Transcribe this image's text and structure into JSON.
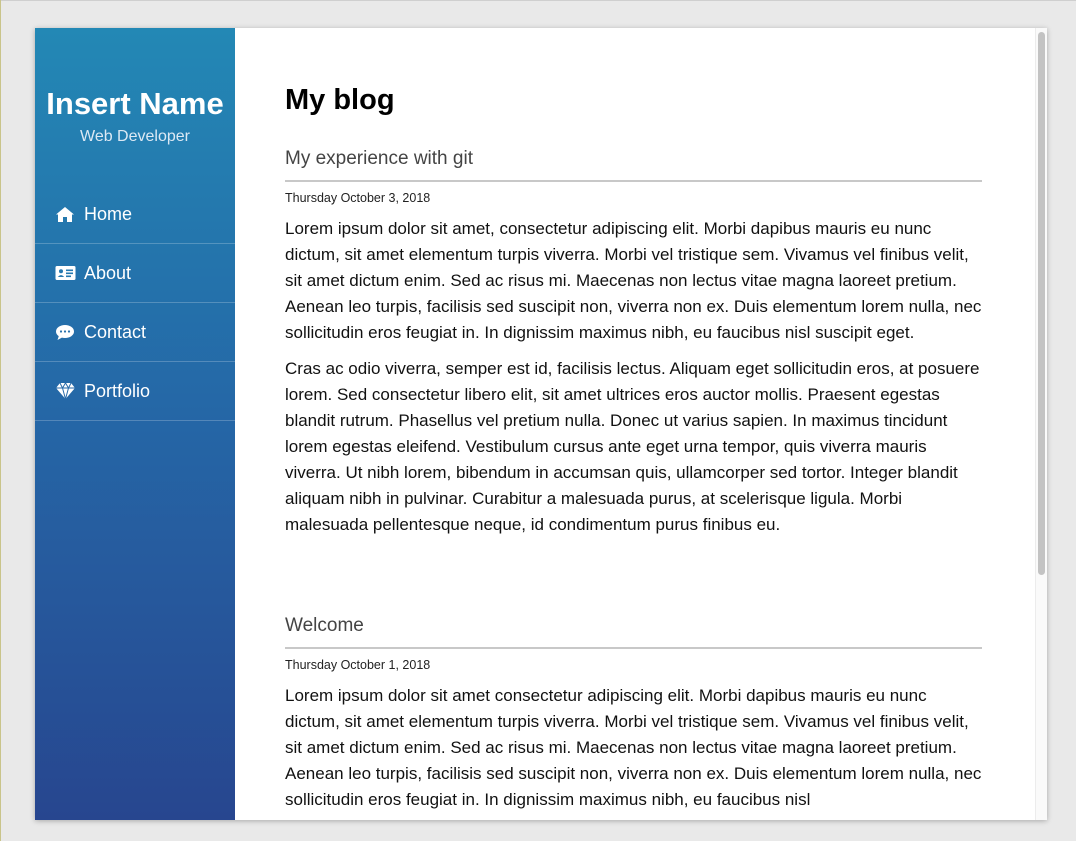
{
  "sidebar": {
    "brand_name": "Insert Name",
    "brand_subtitle": "Web Developer",
    "items": [
      {
        "label": "Home",
        "icon": "home-icon"
      },
      {
        "label": "About",
        "icon": "id-card-icon"
      },
      {
        "label": "Contact",
        "icon": "chat-bubble-icon"
      },
      {
        "label": "Portfolio",
        "icon": "diamond-icon"
      }
    ]
  },
  "main": {
    "title": "My blog",
    "posts": [
      {
        "title": "My experience with git",
        "date": "Thursday October 3, 2018",
        "paragraphs": [
          "Lorem ipsum dolor sit amet, consectetur adipiscing elit. Morbi dapibus mauris eu nunc dictum, sit amet elementum turpis viverra. Morbi vel tristique sem. Vivamus vel finibus velit, sit amet dictum enim. Sed ac risus mi. Maecenas non lectus vitae magna laoreet pretium. Aenean leo turpis, facilisis sed suscipit non, viverra non ex. Duis elementum lorem nulla, nec sollicitudin eros feugiat in. In dignissim maximus nibh, eu faucibus nisl suscipit eget.",
          "Cras ac odio viverra, semper est id, facilisis lectus. Aliquam eget sollicitudin eros, at posuere lorem. Sed consectetur libero elit, sit amet ultrices eros auctor mollis. Praesent egestas blandit rutrum. Phasellus vel pretium nulla. Donec ut varius sapien. In maximus tincidunt lorem egestas eleifend. Vestibulum cursus ante eget urna tempor, quis viverra mauris viverra. Ut nibh lorem, bibendum in accumsan quis, ullamcorper sed tortor. Integer blandit aliquam nibh in pulvinar. Curabitur a malesuada purus, at scelerisque ligula. Morbi malesuada pellentesque neque, id condimentum purus finibus eu."
        ]
      },
      {
        "title": "Welcome",
        "date": "Thursday October 1, 2018",
        "paragraphs": [
          "Lorem ipsum dolor sit amet consectetur adipiscing elit. Morbi dapibus mauris eu nunc dictum, sit amet elementum turpis viverra. Morbi vel tristique sem. Vivamus vel finibus velit, sit amet dictum enim. Sed ac risus mi. Maecenas non lectus vitae magna laoreet pretium. Aenean leo turpis, facilisis sed suscipit non, viverra non ex. Duis elementum lorem nulla, nec sollicitudin eros feugiat in. In dignissim maximus nibh, eu faucibus nisl"
        ]
      }
    ]
  },
  "colors": {
    "sidebar_top": "#2388b5",
    "sidebar_bottom": "#27468f",
    "text": "#111111",
    "post_title": "#444444",
    "divider": "#c8c8c8"
  }
}
